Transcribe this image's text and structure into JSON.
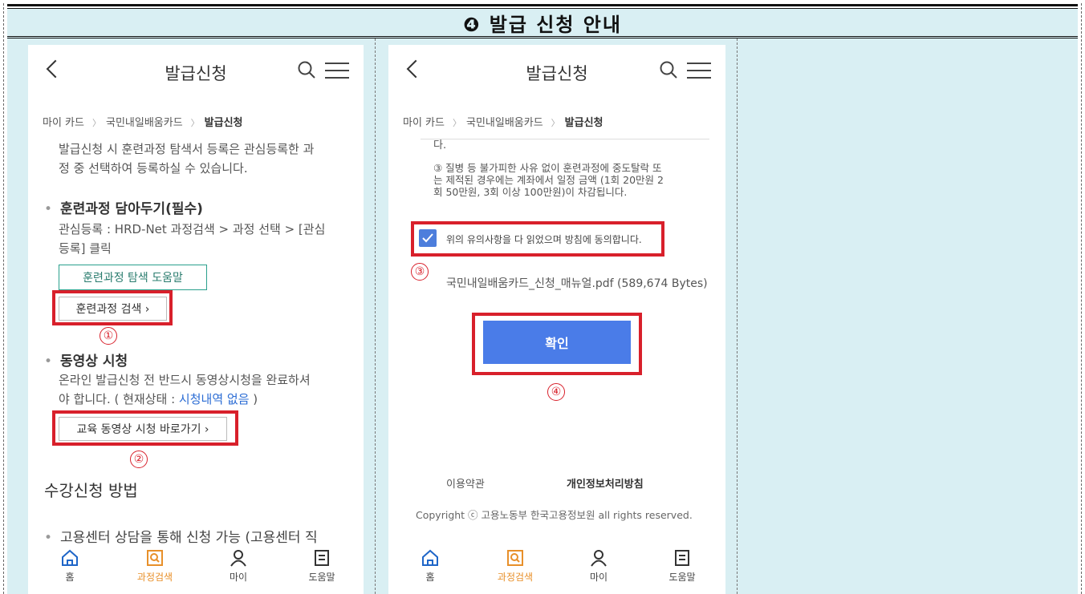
{
  "header": {
    "title": "❹ 발급 신청 안내"
  },
  "left_phone": {
    "app_title": "발급신청",
    "breadcrumb": [
      "마이 카드",
      "국민내일배움카드",
      "발급신청"
    ],
    "intro": [
      "발급신청 시 훈련과정 탐색서 등록은 관심등록한 과",
      "정 중 선택하여 등록하실 수 있습니다."
    ],
    "section1": {
      "heading": "훈련과정 담아두기(필수)",
      "desc": [
        "관심등록 : HRD-Net 과정검색 > 과정 선택 > [관심",
        "등록] 클릭"
      ],
      "help_button": "훈련과정 탐색 도움말",
      "search_button": "훈련과정 검색 ›",
      "marker": "①"
    },
    "section2": {
      "heading": "동영상 시청",
      "desc_line1": "온라인 발급신청 전 반드시 동영상시청을 완료하셔",
      "desc_line2_prefix": "야 합니다. ( 현재상태 : ",
      "desc_line2_link": "시청내역 없음",
      "desc_line2_suffix": " )",
      "video_button": "교육 동영상 시청 바로가기 ›",
      "marker": "②"
    },
    "section3": {
      "title": "수강신청 방법",
      "bullet": "고용센터 상담을 통해 신청 가능 (고용센터 직"
    }
  },
  "right_phone": {
    "app_title": "발급신청",
    "breadcrumb": [
      "마이 카드",
      "국민내일배움카드",
      "발급신청"
    ],
    "partial_text": "다.",
    "notice": [
      "③ 질병 등 불가피한 사유 없이 훈련과정에 중도탈락 또",
      "는 제적된 경우에는 계좌에서 일정 금액 (1회 20만원 2",
      "회 50만원, 3회 이상 100만원)이 차감됩니다."
    ],
    "agree_label": "위의 유의사항을 다 읽었으며 방침에 동의합니다.",
    "agree_checked": true,
    "marker3": "③",
    "file_name": "국민내일배움카드_신청_매뉴얼.pdf (589,674 Bytes)",
    "confirm_button": "확인",
    "marker4": "④",
    "footer_links": [
      "이용약관",
      "개인정보처리방침"
    ],
    "copyright": "Copyright ⓒ 고용노동부 한국고용정보원 all rights reserved."
  },
  "tabs": [
    {
      "label": "홈",
      "icon": "home-icon"
    },
    {
      "label": "과정검색",
      "icon": "course-search-icon",
      "active": true
    },
    {
      "label": "마이",
      "icon": "person-icon"
    },
    {
      "label": "도움말",
      "icon": "help-document-icon"
    }
  ],
  "colors": {
    "panel_bg": "#d9eff3",
    "highlight_red": "#d8202b",
    "active_tab": "#e8902a",
    "primary_blue": "#4a7ce8"
  }
}
